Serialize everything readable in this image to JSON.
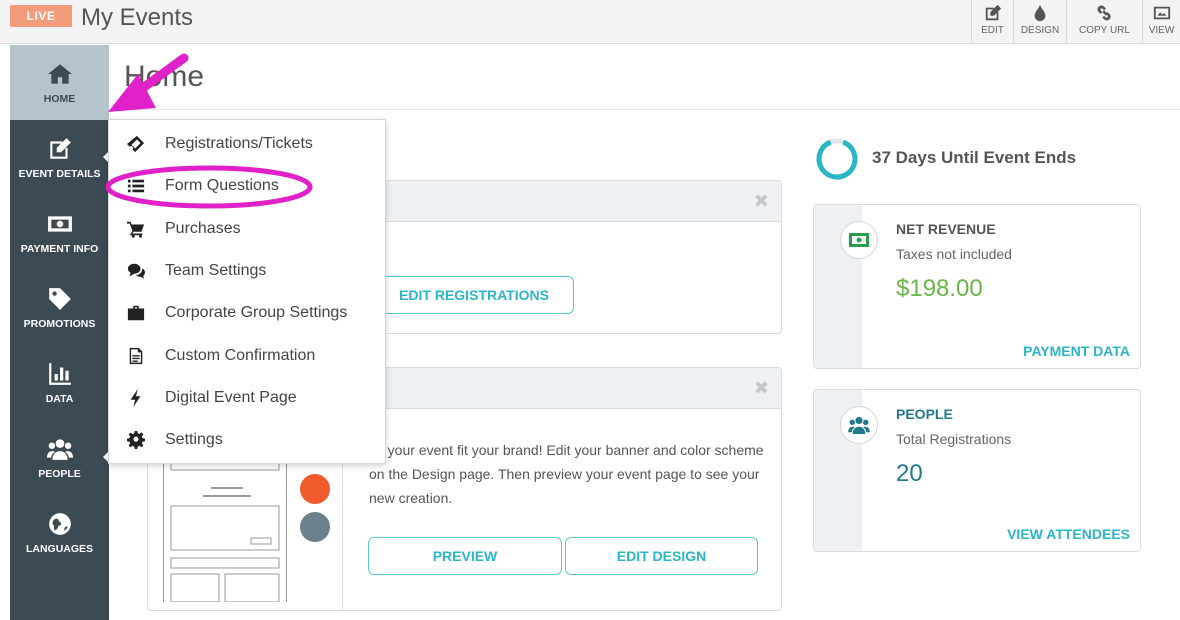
{
  "topbar": {
    "live_label": "LIVE",
    "title": "My Events",
    "actions": [
      {
        "label": "EDIT",
        "icon": "pencil-square-icon"
      },
      {
        "label": "DESIGN",
        "icon": "droplet-icon"
      },
      {
        "label": "COPY URL",
        "icon": "link-icon"
      },
      {
        "label": "VIEW",
        "icon": "image-icon"
      }
    ]
  },
  "sidebar": {
    "items": [
      {
        "label": "HOME",
        "icon": "home-icon"
      },
      {
        "label": "EVENT DETAILS",
        "icon": "edit-icon"
      },
      {
        "label": "PAYMENT INFO",
        "icon": "money-icon"
      },
      {
        "label": "PROMOTIONS",
        "icon": "tag-icon"
      },
      {
        "label": "DATA",
        "icon": "bar-chart-icon"
      },
      {
        "label": "PEOPLE",
        "icon": "users-icon"
      },
      {
        "label": "LANGUAGES",
        "icon": "globe-icon"
      }
    ]
  },
  "main": {
    "page_title": "Home",
    "registrations_card": {
      "button": "EDIT REGISTRATIONS"
    },
    "design_card": {
      "text": "ke your event fit your brand! Edit your banner and color scheme on the Design page. Then preview your event page to see your new creation.",
      "preview_button": "PREVIEW",
      "edit_design_button": "EDIT DESIGN"
    }
  },
  "countdown": {
    "text": "37 Days Until Event Ends"
  },
  "revenue": {
    "label": "NET REVENUE",
    "sub": "Taxes not included",
    "value": "$198.00",
    "link": "PAYMENT DATA",
    "label_color": "#555555",
    "value_color": "#6ab545"
  },
  "people": {
    "label": "PEOPLE",
    "sub": "Total Registrations",
    "value": "20",
    "link": "VIEW ATTENDEES",
    "label_color": "#1f7a8c",
    "value_color": "#1f7a8c"
  },
  "dropdown": {
    "items": [
      {
        "label": "Registrations/Tickets",
        "icon": "ticket-icon"
      },
      {
        "label": "Form Questions",
        "icon": "list-icon"
      },
      {
        "label": "Purchases",
        "icon": "cart-icon"
      },
      {
        "label": "Team Settings",
        "icon": "comments-icon"
      },
      {
        "label": "Corporate Group Settings",
        "icon": "briefcase-icon"
      },
      {
        "label": "Custom Confirmation",
        "icon": "document-icon"
      },
      {
        "label": "Digital Event Page",
        "icon": "bolt-icon"
      },
      {
        "label": "Settings",
        "icon": "cog-icon"
      }
    ]
  },
  "colors": {
    "accent": "#2bb6c5",
    "sidebar": "#3c4a54",
    "annotation": "#e020c8"
  }
}
